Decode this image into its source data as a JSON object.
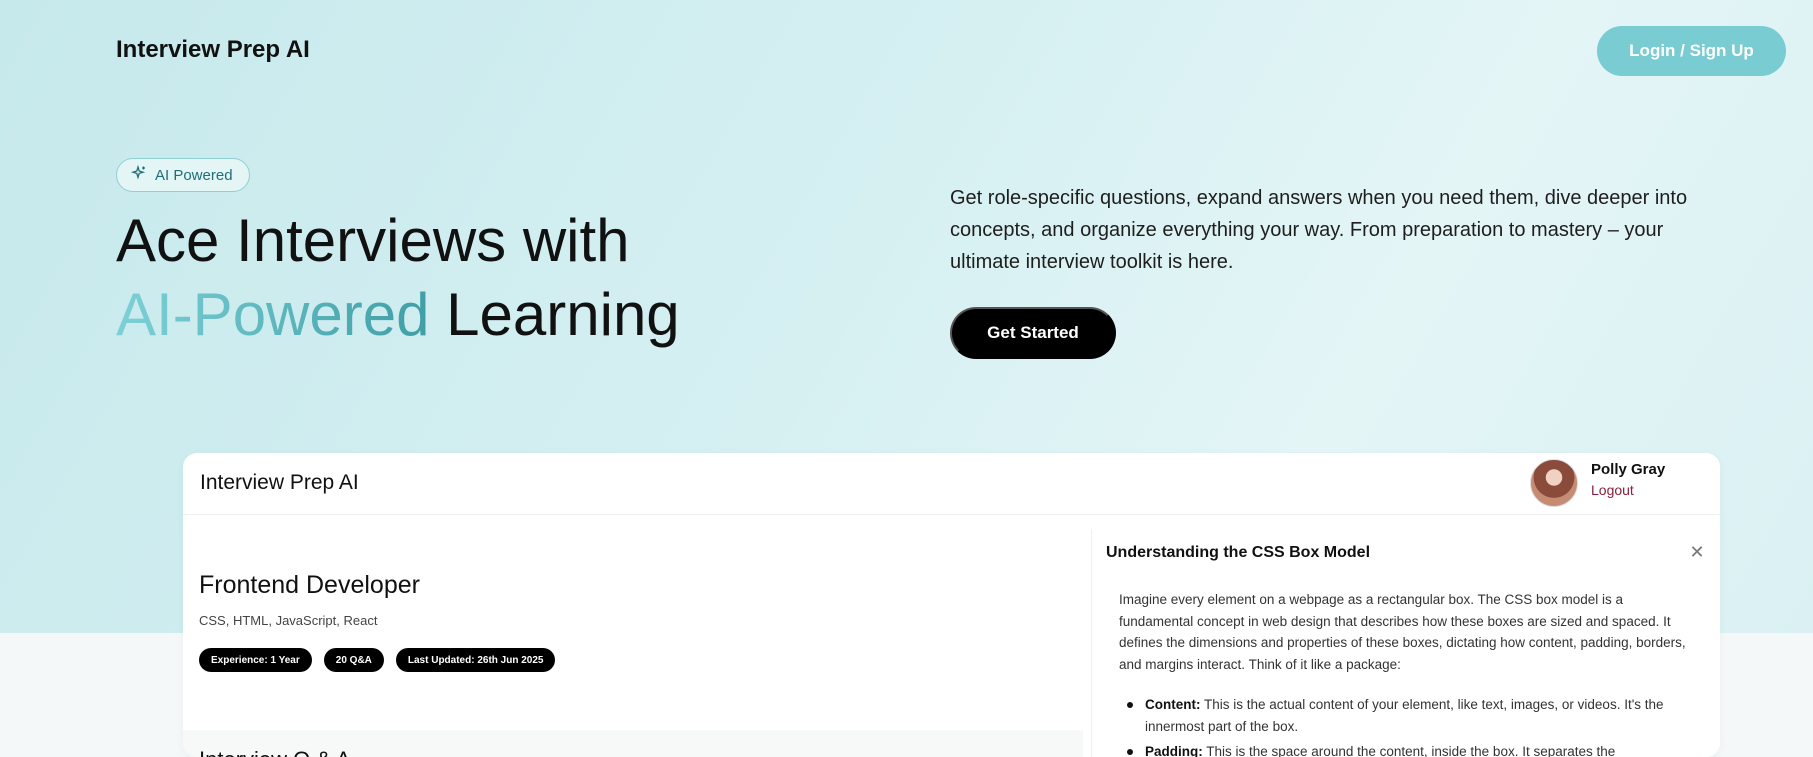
{
  "nav": {
    "brand": "Interview Prep AI",
    "login_label": "Login / Sign Up"
  },
  "hero": {
    "badge_icon": "sparkle-icon",
    "badge_label": "AI Powered",
    "title_line1": "Ace Interviews with",
    "title_accent": "AI-Powered",
    "title_rest": " Learning",
    "description": "Get role-specific questions, expand answers when you need them, dive deeper into concepts, and organize everything your way. From preparation to mastery – your ultimate interview toolkit is here.",
    "cta_label": "Get Started"
  },
  "preview": {
    "brand": "Interview Prep AI",
    "user": {
      "name": "Polly Gray",
      "logout_label": "Logout"
    },
    "session": {
      "role": "Frontend Developer",
      "topics": "CSS, HTML, JavaScript, React",
      "pills": [
        "Experience: 1 Year",
        "20 Q&A",
        "Last Updated: 26th Jun 2025"
      ]
    },
    "qa_heading": "Interview Q & A",
    "drawer": {
      "title": "Understanding the CSS Box Model",
      "close_icon": "close-icon",
      "intro": "Imagine every element on a webpage as a rectangular box. The CSS box model is a fundamental concept in web design that describes how these boxes are sized and spaced. It defines the dimensions and properties of these boxes, dictating how content, padding, borders, and margins interact. Think of it like a package:",
      "items": [
        {
          "term": "Content:",
          "text": " This is the actual content of your element, like text, images, or videos. It's the innermost part of the box."
        },
        {
          "term": "Padding:",
          "text": " This is the space around the content, inside the box. It separates the"
        }
      ]
    }
  },
  "colors": {
    "accent": "#79ccd2",
    "accent_dark": "#3f9ea6",
    "logout": "#8b1e3f"
  }
}
